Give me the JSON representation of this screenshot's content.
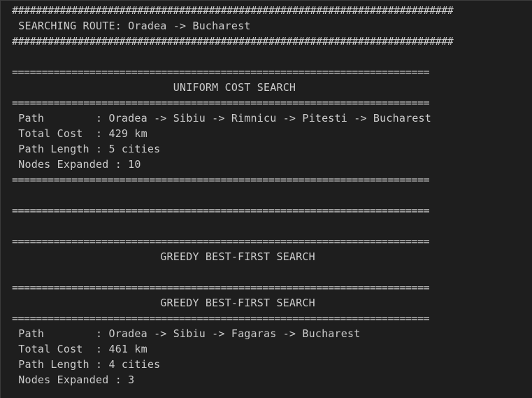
{
  "terminal": {
    "hash_rule": "##########################################################################",
    "route_heading": " SEARCHING ROUTE: Oradea -> Bucharest",
    "eq_rule": "======================================================================",
    "ucs": {
      "title": "                         UNIFORM COST SEARCH",
      "path": " Path        : Oradea -> Sibiu -> Rimnicu -> Pitesti -> Bucharest",
      "total_cost": " Total Cost  : 429 km",
      "path_length": " Path Length : 5 cities",
      "nodes_expanded": " Nodes Expanded : 10"
    },
    "greedy": {
      "title": "                       GREEDY BEST-FIRST SEARCH",
      "path": " Path        : Oradea -> Sibiu -> Fagaras -> Bucharest",
      "total_cost": " Total Cost  : 461 km",
      "path_length": " Path Length : 4 cities",
      "nodes_expanded": " Nodes Expanded : 3"
    }
  }
}
